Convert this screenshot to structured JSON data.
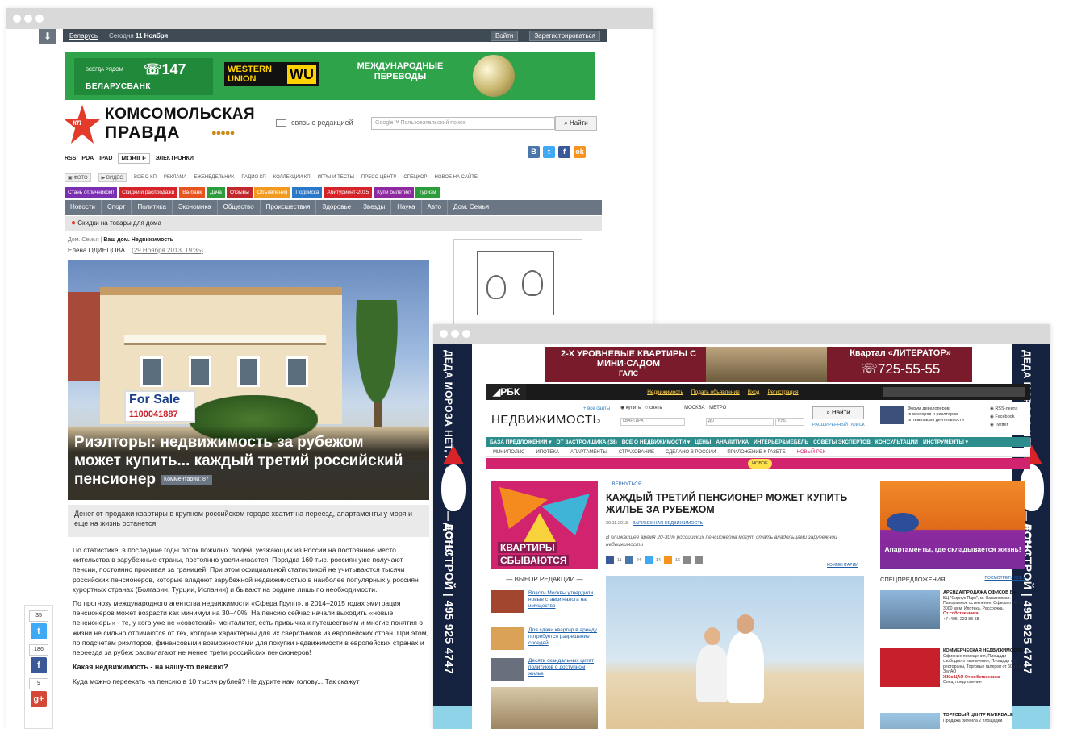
{
  "kp": {
    "topbar": {
      "region": "Беларусь",
      "today_prefix": "Сегодня",
      "today_date": "11 Ноября",
      "login": "Войти",
      "register": "Зарегистрироваться"
    },
    "ad": {
      "bank_small": "всегда рядом",
      "bank_number": "147",
      "bank_name": "БЕЛАРУСБАНК",
      "wu_text": "WESTERN UNION",
      "wu_logo": "WU",
      "transfer_text": "МЕЖДУНАРОДНЫЕ ПЕРЕВОДЫ"
    },
    "logo": {
      "badge": "кп",
      "line1": "КОМСОМОЛЬСКАЯ",
      "line2": "ПРАВДА",
      "medals": "●●●●●"
    },
    "feedback": "связь с редакцией",
    "search_placeholder": "Google™ Пользовательский поиск",
    "find_button": "Найти",
    "links": [
      "RSS",
      "PDA",
      "IPAD",
      "MOBILE",
      "ЭЛЕКТРОНКИ"
    ],
    "menu1": [
      "ФОТО",
      "ВИДЕО",
      "ВСЕ О КП",
      "РЕКЛАМА",
      "ЕЖЕНЕДЕЛЬНИК",
      "РАДИО КП",
      "КОЛЛЕКЦИИ КП",
      "ИГРЫ И ТЕСТЫ",
      "ПРЕСС-ЦЕНТР",
      "СПЕЦКОР",
      "НОВОЕ НА САЙТЕ"
    ],
    "tags": [
      {
        "label": "Стань отличником!",
        "color": "#7b2fb0"
      },
      {
        "label": "Скидки и распродажи",
        "color": "#d6232a"
      },
      {
        "label": "Ва-банк",
        "color": "#e8531f"
      },
      {
        "label": "Дача",
        "color": "#2d9c3a"
      },
      {
        "label": "Отзывы",
        "color": "#c0282d"
      },
      {
        "label": "Объявления",
        "color": "#f29a1f"
      },
      {
        "label": "Подписка",
        "color": "#2a79c8"
      },
      {
        "label": "Абитуриент-2015",
        "color": "#d6232a"
      },
      {
        "label": "Купи билетик!",
        "color": "#8d2aa0"
      },
      {
        "label": "Туризм",
        "color": "#2d9c3a"
      }
    ],
    "nav": [
      "Новости",
      "Спорт",
      "Политика",
      "Экономика",
      "Общество",
      "Происшествия",
      "Здоровье",
      "Звезды",
      "Наука",
      "Авто",
      "Дом. Семья"
    ],
    "strip": "Скидки на товары для дома",
    "crumb_section": "Дом. Семья",
    "crumb_current": "Ваш дом. Недвижимость",
    "author": "Елена ОДИНЦОВА",
    "date": "29 Ноября 2013, 19:35",
    "sale_sign": {
      "line1": "For Sale",
      "line2": "1100041887"
    },
    "headline": "Риэлторы: недвижимость за рубежом может купить... каждый третий российский пенсионер",
    "comments": "Комментарии: 87",
    "lead": "Денег от продажи квартиры в крупном российском городе хватит на переезд, апартаменты у моря и еще на жизнь останется",
    "body": [
      "По статистике, в последние годы поток пожилых людей, уезжающих из России на постоянное место жительства в зарубежные страны, постоянно увеличивается. Порядка 160 тыс. россиян уже получают пенсии, постоянно проживая за границей. При этом официальной статистикой не учитываются тысячи российских пенсионеров, которые владеют зарубежной недвижимостью в наиболее популярных у россиян курортных странах (Болгарии, Турции, Испании) и бывают на родине лишь по необходимости.",
      "По прогнозу международного агентства недвижимости «Сфера Групп», в 2014–2015 годах эмиграция пенсионеров может возрасти как минимум на 30–40%. На пенсию сейчас начали выходить «новые пенсионеры» - те, у кого уже не «советский» менталитет, есть привычка к путешествиям и многие понятия о жизни не сильно отличаются от тех, которые характерны для их сверстников из европейских стран. При этом, по подсчетам риэлторов, финансовыми возможностями для покупки недвижимости в европейских странах и переезда за рубеж располагают не менее трети российских пенсионеров!"
    ],
    "subhead": "Какая недвижимость - на нашу-то пенсию?",
    "body_tail": "Куда можно переехать на пенсию в 10 тысяч рублей? Не дурите нам голову... Так скажут",
    "share_counts": [
      "35",
      "186",
      "9"
    ]
  },
  "rbc": {
    "side_text": "ДЕДА МОРОЗА НЕТ, А СКИДКИ — ЕСТЬ!",
    "side_text2": "ДОНСТРОЙ | 495 925 4747",
    "topad": {
      "left": "2-Х УРОВНЕВЫЕ КВАРТИРЫ С МИНИ-САДОМ",
      "brand": "ГАЛС",
      "right": "Квартал «ЛИТЕРАТОР»",
      "phone": "725-55-55"
    },
    "bar": {
      "logo": "РБК",
      "realty": "Недвижимость",
      "post_ad": "Подать объявление",
      "login": "Вход",
      "register": "Регистрация"
    },
    "section_title": "НЕДВИЖИМОСТЬ",
    "section_small": "+ все сайты",
    "filters": {
      "buy": "купить",
      "rent": "снять",
      "city": "МОСКВА",
      "metro": "МЕТРО",
      "type": "КВАРТИРА",
      "from": "ДО",
      "currency": "РУБ."
    },
    "find_button": "Найти",
    "extended_search": "РАСШИРЕННЫЙ ПОИСК",
    "forum_text": "Форум девелоперов, инвесторов и риэлторов: оптимизация деятельности",
    "right_links": [
      "RSS-лента",
      "Facebook",
      "Twitter"
    ],
    "nav": [
      "БАЗА ПРЕДЛОЖЕНИЙ ▾",
      "ОТ ЗАСТРОЙЩИКА (38)",
      "ВСЕ О НЕДВИЖИМОСТИ ▾",
      "ЦЕНЫ",
      "АНАЛИТИКА",
      "ИНТЕРЬЕР&МЕБЕЛЬ",
      "СОВЕТЫ ЭКСПЕРТОВ",
      "КОНСУЛЬТАЦИИ",
      "ИНСТРУМЕНТЫ ▾"
    ],
    "sub": [
      "МИНИПОЛИС",
      "ИПОТЕКА",
      "АПАРТАМЕНТЫ",
      "СТРАХОВАНИЕ",
      "СДЕЛАНО В РОССИИ",
      "ПРИЛОЖЕНИЕ К ГАЗЕТЕ",
      "НОВЫЙ РБК"
    ],
    "new_badge": "НОВОЕ",
    "promo": [
      "КВАРТИРЫ",
      "СБЫВАЮТСЯ"
    ],
    "editor_title": "ВЫБОР РЕДАКЦИИ",
    "editor_items": [
      "Власти Москвы утвердили новые ставки налога на имущество",
      "Для сдачи квартир в аренду потребуется разрешение соседей",
      "Десять скандальных цитат политиков о доступном жилье"
    ],
    "back": "← ВЕРНУТЬСЯ",
    "title": "КАЖДЫЙ ТРЕТИЙ ПЕНСИОНЕР МОЖЕТ КУПИТЬ ЖИЛЬЕ ЗА РУБЕЖОМ",
    "meta_date": "29.11.2013",
    "meta_section": "ЗАРУБЕЖНАЯ НЕДВИЖИМОСТЬ",
    "lead": "В ближайшее время 20-30% российских пенсионеров могут стать владельцами зарубежной недвижимости",
    "share_counts": [
      "11",
      "24",
      "14",
      "16"
    ],
    "comments": "КОММЕНТАРИИ",
    "apt_text": "Апартаменты, где складывается жизнь!",
    "spec_title": "СПЕЦПРЕДЛОЖЕНИЯ",
    "spec_all": "ПОСМОТРЕТЬ ВСЕ ▸",
    "spec_items": [
      {
        "title": "АРЕНДА/ПРОДАЖА ОФИСОВ B+",
        "desc": "БЦ \"Сириус Парк\", м. Нагатинская. Панорамное остекление. Офисы от 45 до 3000 кв.м. Ипотека. Рассрочка.",
        "owner": "От собственника",
        "phone": "+7 (495) 223-88-88"
      },
      {
        "title": "КОММЕРЧЕСКАЯ НЕДВИЖИМОСТЬ",
        "desc": "Офисные помещения, Площади свободного назначения, Площади под рестораны, Торговые галереи от 60 кв.м в ЗелАО",
        "owner": "ЖК в ЦАО От собственника",
        "phone": "Спец. предложение"
      },
      {
        "title": "ТОРГОВЫЙ ЦЕНТР RIVERDALE",
        "desc": "Продажа ритейла 2 площадей",
        "owner": "",
        "phone": ""
      }
    ]
  },
  "colors": {
    "kp_nav": "#6b7684",
    "kp_topbar": "#404a55",
    "kp_ad_green": "#2fa34a",
    "rbc_nav": "#2d8d8d",
    "rbc_pink": "#d2246e",
    "donstroy_navy": "#14213f"
  }
}
